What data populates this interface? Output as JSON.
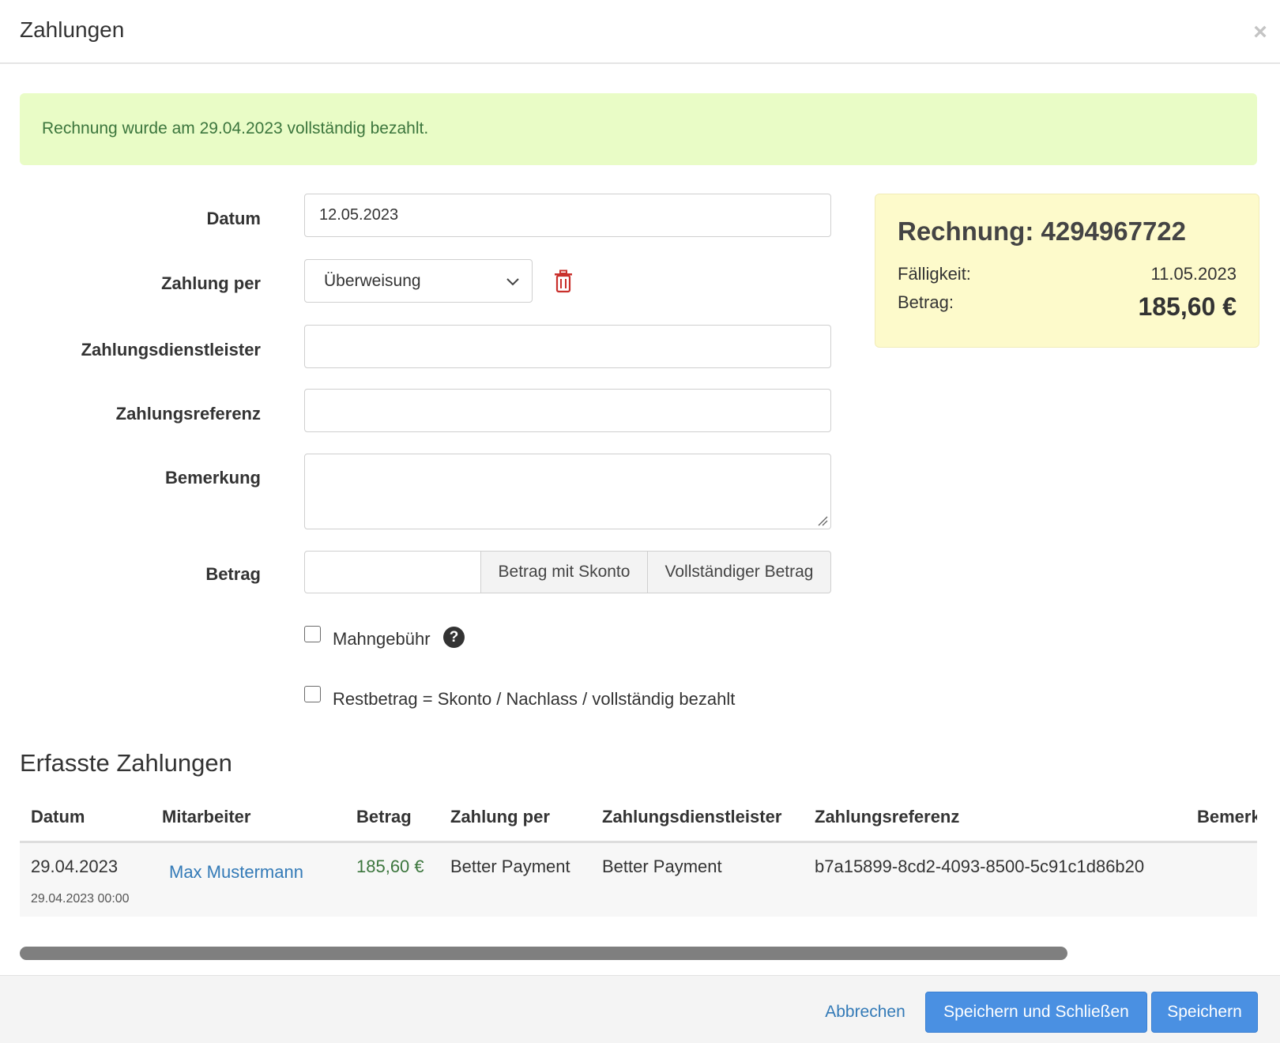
{
  "modal": {
    "title": "Zahlungen",
    "close_symbol": "×"
  },
  "alert": {
    "text": "Rechnung wurde am 29.04.2023 vollständig bezahlt."
  },
  "form": {
    "datum": {
      "label": "Datum",
      "value": "12.05.2023"
    },
    "zahlung_per": {
      "label": "Zahlung per",
      "value": "Überweisung"
    },
    "zahlungsdienstleister": {
      "label": "Zahlungsdienstleister",
      "value": ""
    },
    "zahlungsreferenz": {
      "label": "Zahlungsreferenz",
      "value": ""
    },
    "bemerkung": {
      "label": "Bemerkung",
      "value": ""
    },
    "betrag": {
      "label": "Betrag",
      "value": "",
      "btn_skonto": "Betrag mit Skonto",
      "btn_voll": "Vollständiger Betrag"
    },
    "mahngebuehr": {
      "label": "Mahngebühr",
      "checked": false
    },
    "restbetrag": {
      "label": "Restbetrag = Skonto / Nachlass / vollständig bezahlt",
      "checked": false
    }
  },
  "summary": {
    "title": "Rechnung: 4294967722",
    "faelligkeit_label": "Fälligkeit:",
    "faelligkeit_value": "11.05.2023",
    "betrag_label": "Betrag:",
    "betrag_value": "185,60 €"
  },
  "payments": {
    "title": "Erfasste Zahlungen",
    "headers": [
      "Datum",
      "Mitarbeiter",
      "Betrag",
      "Zahlung per",
      "Zahlungsdienstleister",
      "Zahlungsreferenz",
      "Bemerkung"
    ],
    "rows": [
      {
        "datum": "29.04.2023",
        "datum_sub": "29.04.2023 00:00",
        "mitarbeiter": "Max Mustermann",
        "betrag": "185,60 €",
        "zahlung_per": "Better Payment",
        "dienstleister": "Better Payment",
        "referenz": "b7a15899-8cd2-4093-8500-5c91c1d86b20"
      }
    ]
  },
  "footer": {
    "cancel": "Abbrechen",
    "save_close": "Speichern und Schließen",
    "save": "Speichern"
  },
  "colors": {
    "alert_bg": "#e9fcc6",
    "alert_text": "#3c763d",
    "summary_bg": "#fdfacb",
    "primary": "#4a90e2",
    "link": "#337ab7",
    "trash": "#c9302c"
  },
  "icons": {
    "close": "close-icon",
    "chevron": "chevron-down-icon",
    "trash": "trash-icon",
    "help": "question-circle-icon"
  }
}
